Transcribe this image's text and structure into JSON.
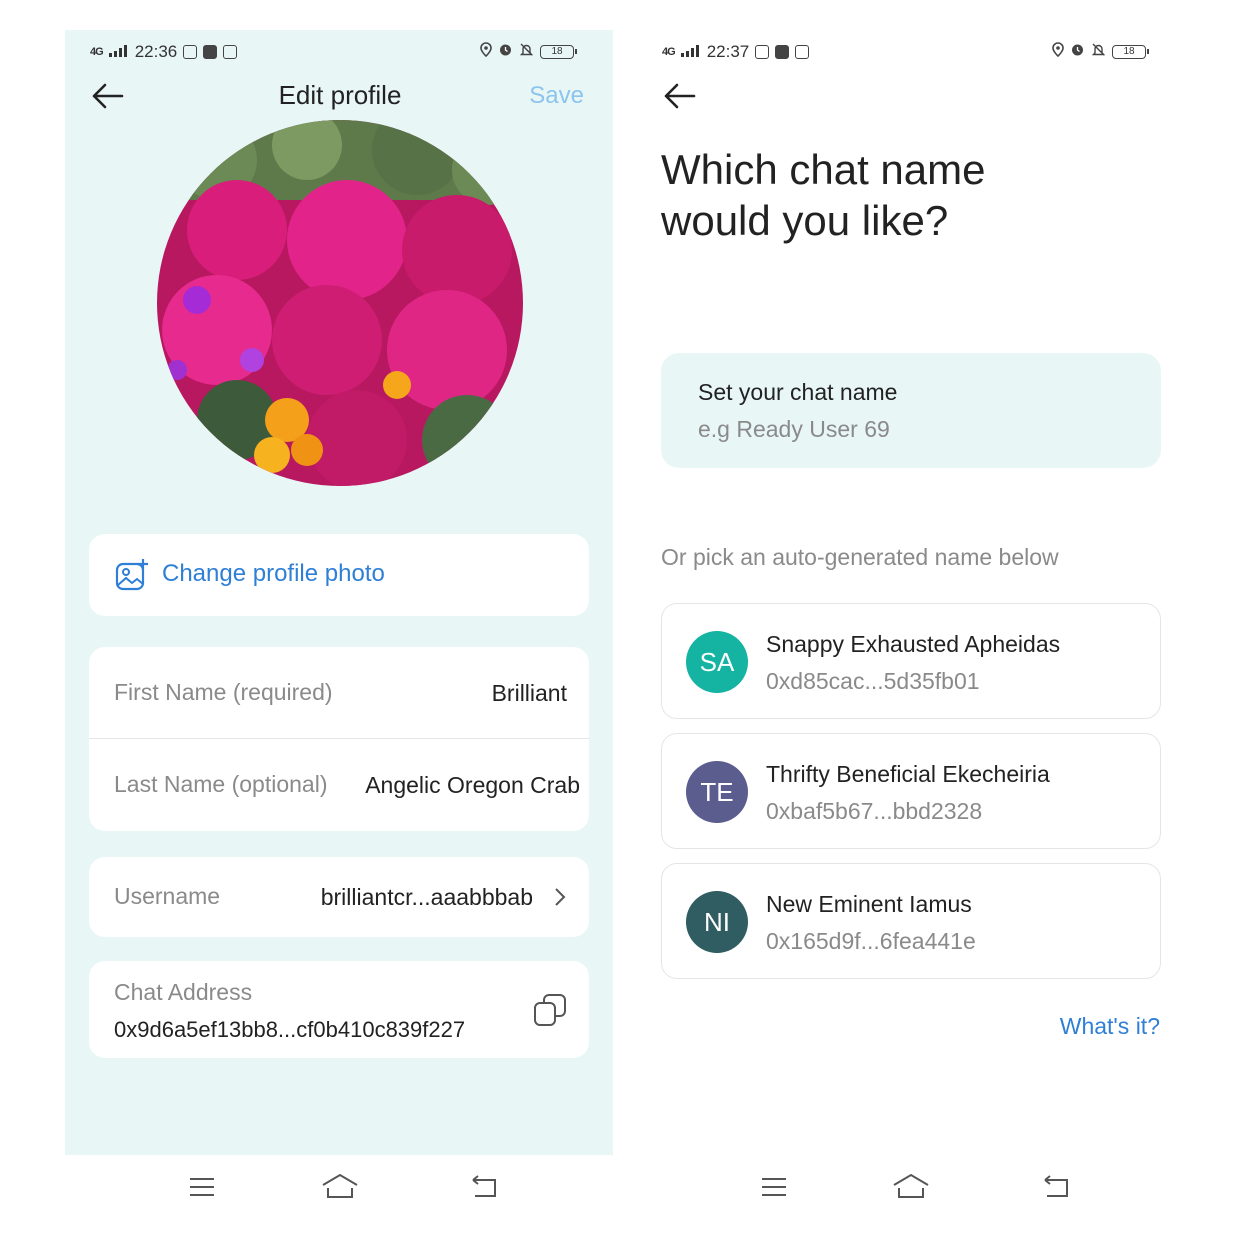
{
  "left": {
    "status": {
      "network": "4G",
      "time": "22:36",
      "battery": "18"
    },
    "header": {
      "title": "Edit profile",
      "save_label": "Save"
    },
    "photo_action": {
      "label": "Change profile photo"
    },
    "fields": {
      "first_name": {
        "label": "First Name (required)",
        "value": "Brilliant"
      },
      "last_name": {
        "label": "Last Name (optional)",
        "value": "Angelic Oregon Crab"
      },
      "username": {
        "label": "Username",
        "value": "brilliantcr...aaabbbab"
      },
      "chat_address": {
        "label": "Chat Address",
        "value": "0x9d6a5ef13bb8...cf0b410c839f227"
      }
    }
  },
  "right": {
    "status": {
      "network": "4G",
      "time": "22:37",
      "battery": "18"
    },
    "title_line1": "Which chat name",
    "title_line2": "would you like?",
    "input": {
      "label": "Set your chat name",
      "placeholder": "e.g Ready User 69"
    },
    "subheading": "Or pick an auto-generated name below",
    "names": [
      {
        "initials": "SA",
        "name": "Snappy Exhausted Apheidas",
        "address": "0xd85cac...5d35fb01",
        "color": "#14b3a2"
      },
      {
        "initials": "TE",
        "name": "Thrifty Beneficial Ekecheiria",
        "address": "0xbaf5b67...bbd2328",
        "color": "#5b5d8f"
      },
      {
        "initials": "NI",
        "name": "New Eminent Iamus",
        "address": "0x165d9f...6fea441e",
        "color": "#2f5d62"
      }
    ],
    "help_link": "What's it?"
  },
  "colors": {
    "accent": "#2f7fd6",
    "panel_bg": "#e8f7f6",
    "input_bg": "#e8f7f6"
  }
}
